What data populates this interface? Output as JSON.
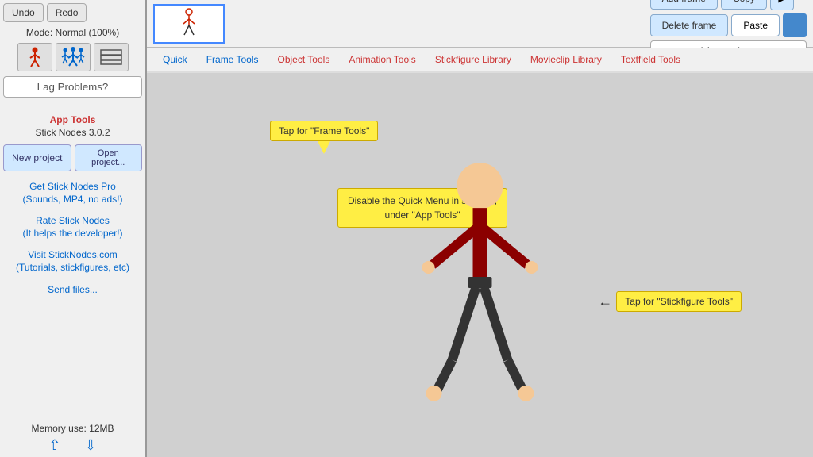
{
  "sidebar": {
    "undo_label": "Undo",
    "redo_label": "Redo",
    "mode_label": "Mode: Normal (100%)",
    "lag_label": "Lag Problems?",
    "app_tools_title": "App Tools",
    "app_tools_version": "Stick Nodes 3.0.2",
    "new_project_label": "New project",
    "open_project_label": "Open project...",
    "pro_label": "Get Stick Nodes Pro\n(Sounds, MP4, no ads!)",
    "rate_label": "Rate Stick Nodes\n(It helps the developer!)",
    "visit_label": "Visit StickNodes.com\n(Tutorials, stickfigures, etc)",
    "send_label": "Send files...",
    "memory_label": "Memory use: 12MB"
  },
  "topbar": {
    "add_frame_label": "Add frame",
    "copy_label": "Copy",
    "delete_frame_label": "Delete frame",
    "paste_label": "Paste",
    "view_options_label": "View options"
  },
  "tabs": {
    "items": [
      {
        "label": "Quick"
      },
      {
        "label": "Frame Tools"
      },
      {
        "label": "Object Tools"
      },
      {
        "label": "Animation Tools"
      },
      {
        "label": "Stickfigure Library"
      },
      {
        "label": "Movieclip Library"
      },
      {
        "label": "Textfield Tools"
      }
    ]
  },
  "tooltips": {
    "frame_tools": "Tap for \"Frame Tools\"",
    "quick_menu": "Disable the Quick Menu in settings,\nunder \"App Tools\"",
    "stickfigure_tools": "Tap for \"Stickfigure Tools\""
  }
}
